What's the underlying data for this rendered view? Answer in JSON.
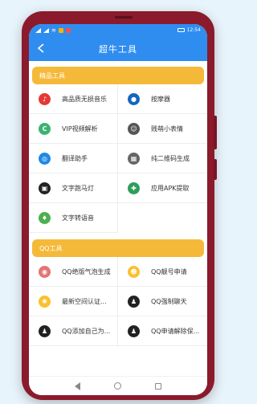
{
  "status_bar": {
    "left_icons": [
      "signal-icon",
      "signal-icon",
      "wifi-icon",
      "app-notification-icon",
      "app-notification-icon"
    ],
    "time": "12:54"
  },
  "app_bar": {
    "title": "超牛工具",
    "back_icon": "back-arrow-icon"
  },
  "sections": [
    {
      "title": "精品工具",
      "tools": [
        {
          "label": "高品质无损音乐",
          "icon": "music-icon",
          "color": "#e53935",
          "glyph": "♪"
        },
        {
          "label": "按摩器",
          "icon": "massage-icon",
          "color": "#1565c0",
          "glyph": "●"
        },
        {
          "label": "VIP视频解析",
          "icon": "vip-video-icon",
          "color": "#3cb371",
          "glyph": "C"
        },
        {
          "label": "贱萌小表情",
          "icon": "emoji-face-icon",
          "color": "#555555",
          "glyph": "☺"
        },
        {
          "label": "翻译助手",
          "icon": "translate-icon",
          "color": "#1e88e5",
          "glyph": "◎"
        },
        {
          "label": "纯二维码生成",
          "icon": "qr-code-icon",
          "color": "#666666",
          "glyph": "▦"
        },
        {
          "label": "文字跑马灯",
          "icon": "marquee-icon",
          "color": "#222222",
          "glyph": "▣"
        },
        {
          "label": "应用APK提取",
          "icon": "apk-icon",
          "color": "#2e9e5b",
          "glyph": "✚"
        },
        {
          "label": "文字转语音",
          "icon": "microphone-icon",
          "color": "#4caf50",
          "glyph": "♦"
        }
      ]
    },
    {
      "title": "QQ工具",
      "tools": [
        {
          "label": "QQ绝版气泡生成",
          "icon": "bubble-icon",
          "color": "#e57373",
          "glyph": "◉"
        },
        {
          "label": "QQ靓号申请",
          "icon": "smiley-icon",
          "color": "#fbc02d",
          "glyph": "☻"
        },
        {
          "label": "最新空间认证...",
          "icon": "badge-icon",
          "color": "#fbc02d",
          "glyph": "✺"
        },
        {
          "label": "QQ强制聊天",
          "icon": "qq-penguin-icon",
          "color": "#222222",
          "glyph": "♟"
        },
        {
          "label": "QQ添加自己为...",
          "icon": "qq-penguin-icon",
          "color": "#222222",
          "glyph": "♟"
        },
        {
          "label": "QQ申请解除保...",
          "icon": "qq-penguin-icon",
          "color": "#222222",
          "glyph": "♟"
        }
      ]
    }
  ]
}
